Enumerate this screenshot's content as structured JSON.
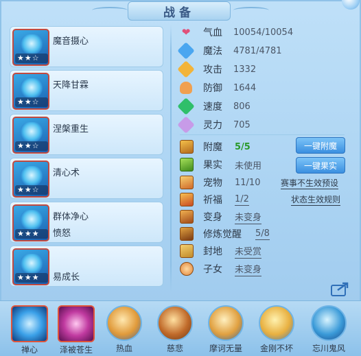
{
  "title": "战备",
  "skills": [
    {
      "name": "魔音摄心",
      "sub": "",
      "stars": "★★☆"
    },
    {
      "name": "天降甘霖",
      "sub": "",
      "stars": "★★☆"
    },
    {
      "name": "涅槃重生",
      "sub": "",
      "stars": "★★☆"
    },
    {
      "name": "清心术",
      "sub": "",
      "stars": "★★☆"
    },
    {
      "name": "群体净心",
      "sub": "愤怒",
      "stars": "★★★"
    },
    {
      "name": "",
      "sub": "易成长",
      "stars": "★★★"
    }
  ],
  "stats": [
    {
      "label": "气血",
      "value": "10054/10054",
      "icon": "heart-icon"
    },
    {
      "label": "魔法",
      "value": "4781/4781",
      "icon": "mana-icon"
    },
    {
      "label": "攻击",
      "value": "1332",
      "icon": "attack-icon"
    },
    {
      "label": "防御",
      "value": "1644",
      "icon": "defense-icon"
    },
    {
      "label": "速度",
      "value": "806",
      "icon": "speed-icon"
    },
    {
      "label": "灵力",
      "value": "705",
      "icon": "spirit-icon"
    }
  ],
  "features": [
    {
      "label": "附魔",
      "value": "5/5"
    },
    {
      "label": "果实",
      "value": "未使用"
    },
    {
      "label": "宠物",
      "value": "11/10"
    },
    {
      "label": "祈福",
      "value": "1/2"
    },
    {
      "label": "变身",
      "value": "未变身"
    },
    {
      "label": "修炼觉醒",
      "value": "5/8"
    },
    {
      "label": "封地",
      "value": "未受赏"
    },
    {
      "label": "子女",
      "value": "未变身"
    }
  ],
  "buttons": {
    "enchant": "一键附魔",
    "fruit": "一键果实"
  },
  "links": {
    "event_preset": "赛事不生效预设",
    "status_rules": "状态生效规则"
  },
  "bottom_skills": [
    {
      "label": "禅心"
    },
    {
      "label": "泽被苍生"
    },
    {
      "label": "热血"
    },
    {
      "label": "慈悲"
    },
    {
      "label": "摩诃无量"
    },
    {
      "label": "金刚不坏"
    },
    {
      "label": "忘川鬼风"
    }
  ]
}
